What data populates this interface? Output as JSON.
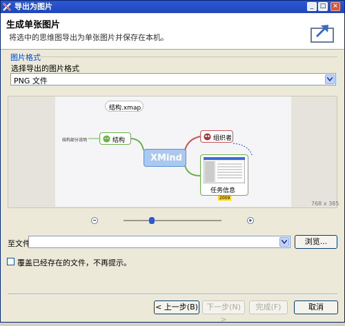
{
  "window": {
    "title": "导出为图片"
  },
  "header": {
    "title": "生成单张图片",
    "description": "将选中的思维图导出为单张图片并保存在本机。"
  },
  "format_group": {
    "label": "图片格式",
    "select_label": "选择导出的图片格式",
    "selected": "PNG 文件"
  },
  "preview": {
    "dimensions": "768 x 385",
    "nodes": {
      "file": "结构.xmap",
      "center": "XMind",
      "structure": "结构",
      "left_label": "结构部分说明",
      "organizer": "组织者",
      "task": "任务信息",
      "task_badge": "2009"
    }
  },
  "file": {
    "label": "至文件:",
    "value": "",
    "browse": "浏览..."
  },
  "overwrite": {
    "label": "覆盖已经存在的文件，不再提示。",
    "checked": false
  },
  "buttons": {
    "back": "< 上一步(B)",
    "next": "下一步(N) >",
    "finish": "完成(F)",
    "cancel": "取消"
  }
}
